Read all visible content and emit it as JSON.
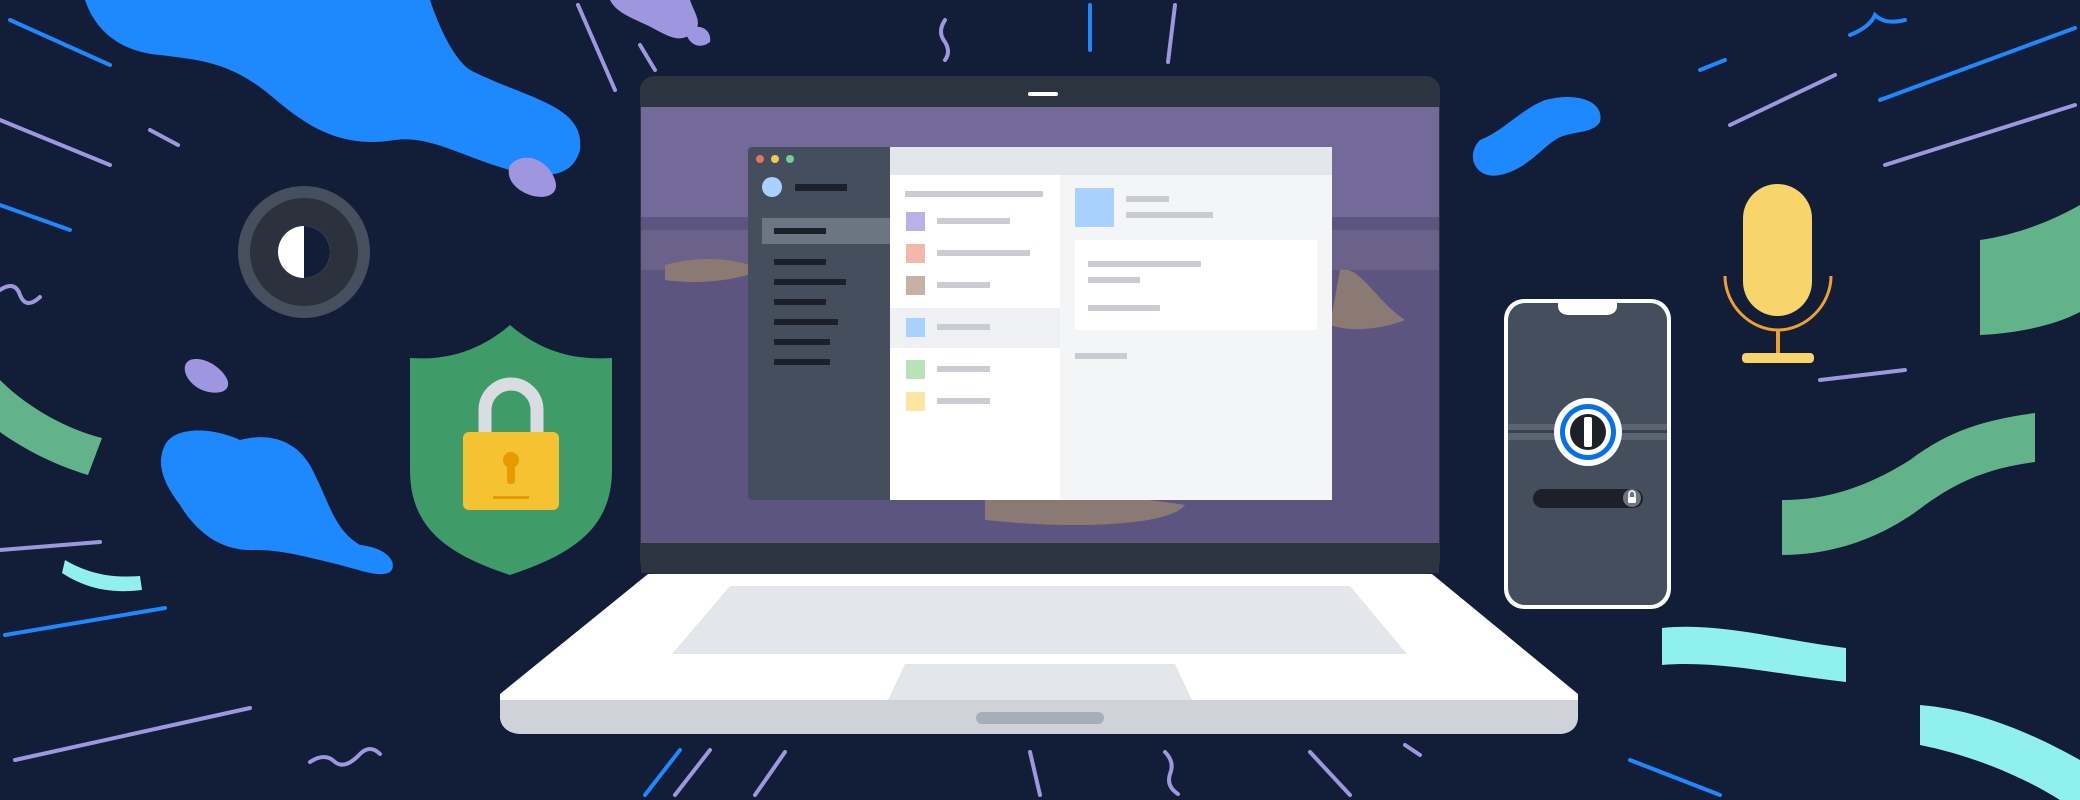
{
  "illustration": {
    "background_color": "#121d38",
    "elements": {
      "laptop": {
        "has_visible_text": false
      },
      "app_window": {
        "traffic_lights": [
          "#e8735f",
          "#f2c94c",
          "#6fcf97"
        ]
      },
      "phone": {
        "app_icon": "1password-keyhole-icon",
        "lock_icon": "lock-icon"
      },
      "shield": {
        "color": "#3f9b68",
        "icon": "padlock-icon"
      },
      "toggle_icon": "contrast-toggle-icon",
      "microphone_icon": "microphone-icon"
    },
    "palette": {
      "blue": "#1e88ff",
      "purple": "#9e97df",
      "green": "#62b38a",
      "cyan": "#8ff0ee",
      "yellow": "#f7d56a",
      "dark": "#121d38"
    }
  }
}
